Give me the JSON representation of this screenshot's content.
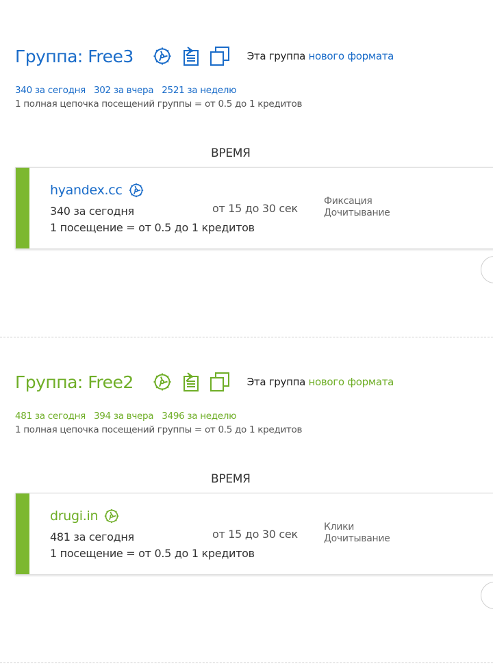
{
  "colors": {
    "group1_accent": "#1a6cc9",
    "group2_accent": "#6fae27",
    "card_stripe": "#7cb82f"
  },
  "groups": [
    {
      "title": "Группа: Free3",
      "icons": [
        "gear-icon",
        "clipboard-pin-icon",
        "copy-icon"
      ],
      "format_prefix": "Эта группа",
      "format_link": "нового формата",
      "stats": {
        "today": "340 за сегодня",
        "yesterday": "302 за вчера",
        "week": "2521 за неделю"
      },
      "chain_note": "1 полная цепочка посещений группы = от 0.5 до 1 кредитов",
      "time_header": "ВРЕМЯ",
      "site": {
        "name": "hyandex.cc",
        "icon": "gear-icon",
        "today": "340 за сегодня",
        "credits": "1 посещение = от 0.5 до 1 кредитов",
        "time": "от 15 до 30 сек",
        "tags": [
          "Фиксация",
          "Дочитывание"
        ]
      }
    },
    {
      "title": "Группа: Free2",
      "icons": [
        "gear-icon",
        "clipboard-pin-icon",
        "copy-icon"
      ],
      "format_prefix": "Эта группа",
      "format_link": "нового формата",
      "stats": {
        "today": "481 за сегодня",
        "yesterday": "394 за вчера",
        "week": "3496 за неделю"
      },
      "chain_note": "1 полная цепочка посещений группы = от 0.5 до 1 кредитов",
      "time_header": "ВРЕМЯ",
      "site": {
        "name": "drugi.in",
        "icon": "gear-icon",
        "today": "481 за сегодня",
        "credits": "1 посещение = от 0.5 до 1 кредитов",
        "time": "от 15 до 30 сек",
        "tags": [
          "Клики",
          "Дочитывание"
        ]
      }
    }
  ]
}
